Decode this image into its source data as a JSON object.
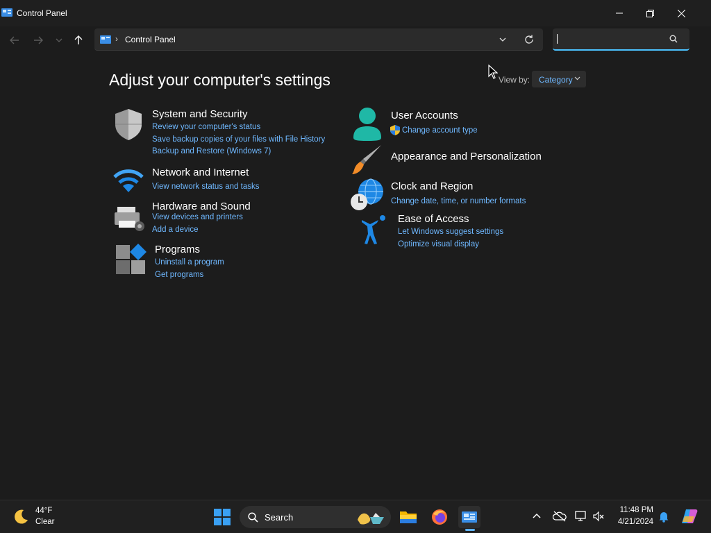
{
  "window": {
    "title": "Control Panel"
  },
  "address_bar": {
    "crumb_separator": "›",
    "crumb": "Control Panel"
  },
  "search": {
    "placeholder": ""
  },
  "main": {
    "heading": "Adjust your computer's settings",
    "view_by_label": "View by:",
    "view_by_value": "Category",
    "categories_left": [
      {
        "title": "System and Security",
        "links": [
          "Review your computer's status",
          "Save backup copies of your files with File History",
          "Backup and Restore (Windows 7)"
        ]
      },
      {
        "title": "Network and Internet",
        "links": [
          "View network status and tasks"
        ]
      },
      {
        "title": "Hardware and Sound",
        "links": [
          "View devices and printers",
          "Add a device"
        ]
      },
      {
        "title": "Programs",
        "links": [
          "Uninstall a program",
          "Get programs"
        ]
      }
    ],
    "categories_right": [
      {
        "title": "User Accounts",
        "links": [
          "Change account type"
        ]
      },
      {
        "title": "Appearance and Personalization",
        "links": []
      },
      {
        "title": "Clock and Region",
        "links": [
          "Change date, time, or number formats"
        ]
      },
      {
        "title": "Ease of Access",
        "links": [
          "Let Windows suggest settings",
          "Optimize visual display"
        ]
      }
    ]
  },
  "taskbar": {
    "weather_temp": "44°F",
    "weather_condition": "Clear",
    "search_label": "Search",
    "time": "11:48 PM",
    "date": "4/21/2024"
  },
  "colors": {
    "link": "#6fb8ff",
    "accent": "#4cc2ff",
    "background": "#1c1c1c"
  }
}
